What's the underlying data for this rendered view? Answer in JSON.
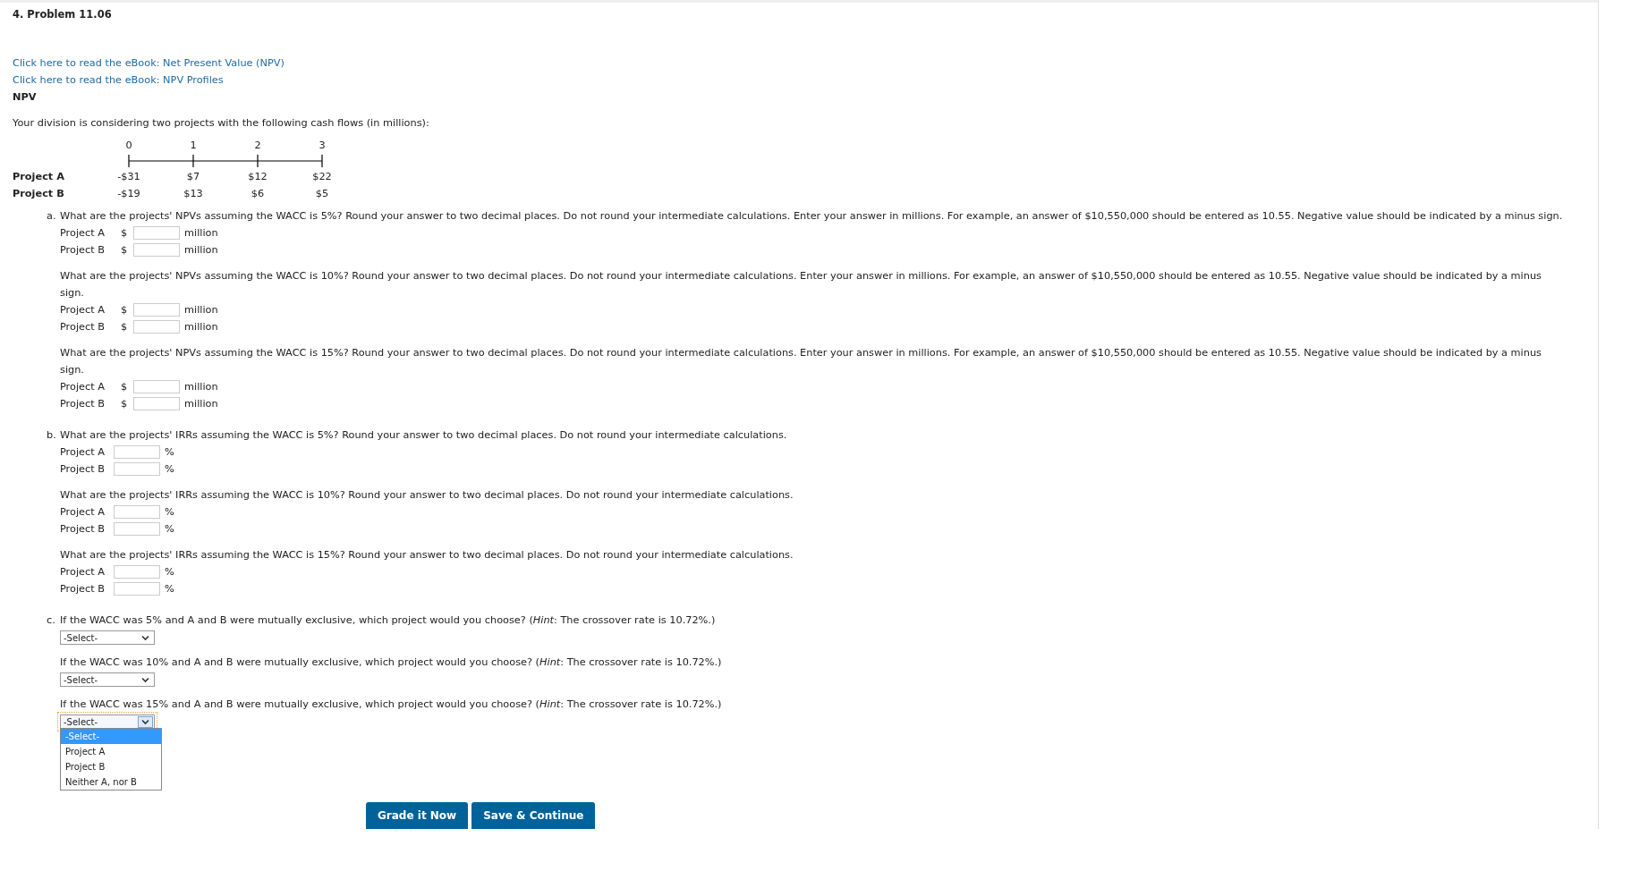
{
  "problem_title": "4. Problem 11.06",
  "links": [
    "Click here to read the eBook: Net Present Value (NPV)",
    "Click here to read the eBook: NPV Profiles"
  ],
  "section_heading": "NPV",
  "intro": "Your division is considering two projects with the following cash flows (in millions):",
  "timeline": {
    "periods": [
      "0",
      "1",
      "2",
      "3"
    ],
    "projects": [
      {
        "name": "Project A",
        "cash_flows": [
          "-$31",
          "$7",
          "$12",
          "$22"
        ]
      },
      {
        "name": "Project B",
        "cash_flows": [
          "-$19",
          "$13",
          "$6",
          "$5"
        ]
      }
    ]
  },
  "parts": [
    {
      "letter": "a.",
      "questions": [
        {
          "kind": "amount",
          "text": "What are the projects' NPVs assuming the WACC is 5%? Round your answer to two decimal places. Do not round your intermediate calculations. Enter your answer in millions. For example, an answer of $10,550,000 should be entered as 10.55. Negative value should be indicated by a minus sign.",
          "rows": [
            {
              "label": "Project A",
              "prefix": "$",
              "unit": "million"
            },
            {
              "label": "Project B",
              "prefix": "$",
              "unit": "million"
            }
          ]
        },
        {
          "kind": "amount",
          "text": "What are the projects' NPVs assuming the WACC is 10%? Round your answer to two decimal places. Do not round your intermediate calculations. Enter your answer in millions. For example, an answer of $10,550,000 should be entered as 10.55. Negative value should be indicated by a minus sign.",
          "rows": [
            {
              "label": "Project A",
              "prefix": "$",
              "unit": "million"
            },
            {
              "label": "Project B",
              "prefix": "$",
              "unit": "million"
            }
          ]
        },
        {
          "kind": "amount",
          "text": "What are the projects' NPVs assuming the WACC is 15%? Round your answer to two decimal places. Do not round your intermediate calculations. Enter your answer in millions. For example, an answer of $10,550,000 should be entered as 10.55. Negative value should be indicated by a minus sign.",
          "rows": [
            {
              "label": "Project A",
              "prefix": "$",
              "unit": "million"
            },
            {
              "label": "Project B",
              "prefix": "$",
              "unit": "million"
            }
          ]
        }
      ]
    },
    {
      "letter": "b.",
      "questions": [
        {
          "kind": "percent",
          "text": "What are the projects' IRRs assuming the WACC is 5%? Round your answer to two decimal places. Do not round your intermediate calculations.",
          "rows": [
            {
              "label": "Project A",
              "unit": "%"
            },
            {
              "label": "Project B",
              "unit": "%"
            }
          ]
        },
        {
          "kind": "percent",
          "text": "What are the projects' IRRs assuming the WACC is 10%? Round your answer to two decimal places. Do not round your intermediate calculations.",
          "rows": [
            {
              "label": "Project A",
              "unit": "%"
            },
            {
              "label": "Project B",
              "unit": "%"
            }
          ]
        },
        {
          "kind": "percent",
          "text": "What are the projects' IRRs assuming the WACC is 15%? Round your answer to two decimal places. Do not round your intermediate calculations.",
          "rows": [
            {
              "label": "Project A",
              "unit": "%"
            },
            {
              "label": "Project B",
              "unit": "%"
            }
          ]
        }
      ]
    },
    {
      "letter": "c.",
      "questions": [
        {
          "kind": "select",
          "text": "If the WACC was 5% and A and B were mutually exclusive, which project would you choose? (*Hint*: The crossover rate is 10.72%.)",
          "select": {
            "value": "-Select-",
            "expanded": false
          }
        },
        {
          "kind": "select",
          "text": "If the WACC was 10% and A and B were mutually exclusive, which project would you choose? (*Hint*: The crossover rate is 10.72%.)",
          "select": {
            "value": "-Select-",
            "expanded": false
          }
        },
        {
          "kind": "select",
          "text": "If the WACC was 15% and A and B were mutually exclusive, which project would you choose? (*Hint*: The crossover rate is 10.72%.)",
          "select": {
            "value": "-Select-",
            "expanded": true,
            "options": [
              {
                "label": "-Select-",
                "selected": true
              },
              {
                "label": "Project A",
                "selected": false
              },
              {
                "label": "Project B",
                "selected": false
              },
              {
                "label": "Neither A, nor B",
                "selected": false
              }
            ]
          }
        }
      ]
    }
  ],
  "buttons": [
    "Grade it Now",
    "Save & Continue"
  ]
}
